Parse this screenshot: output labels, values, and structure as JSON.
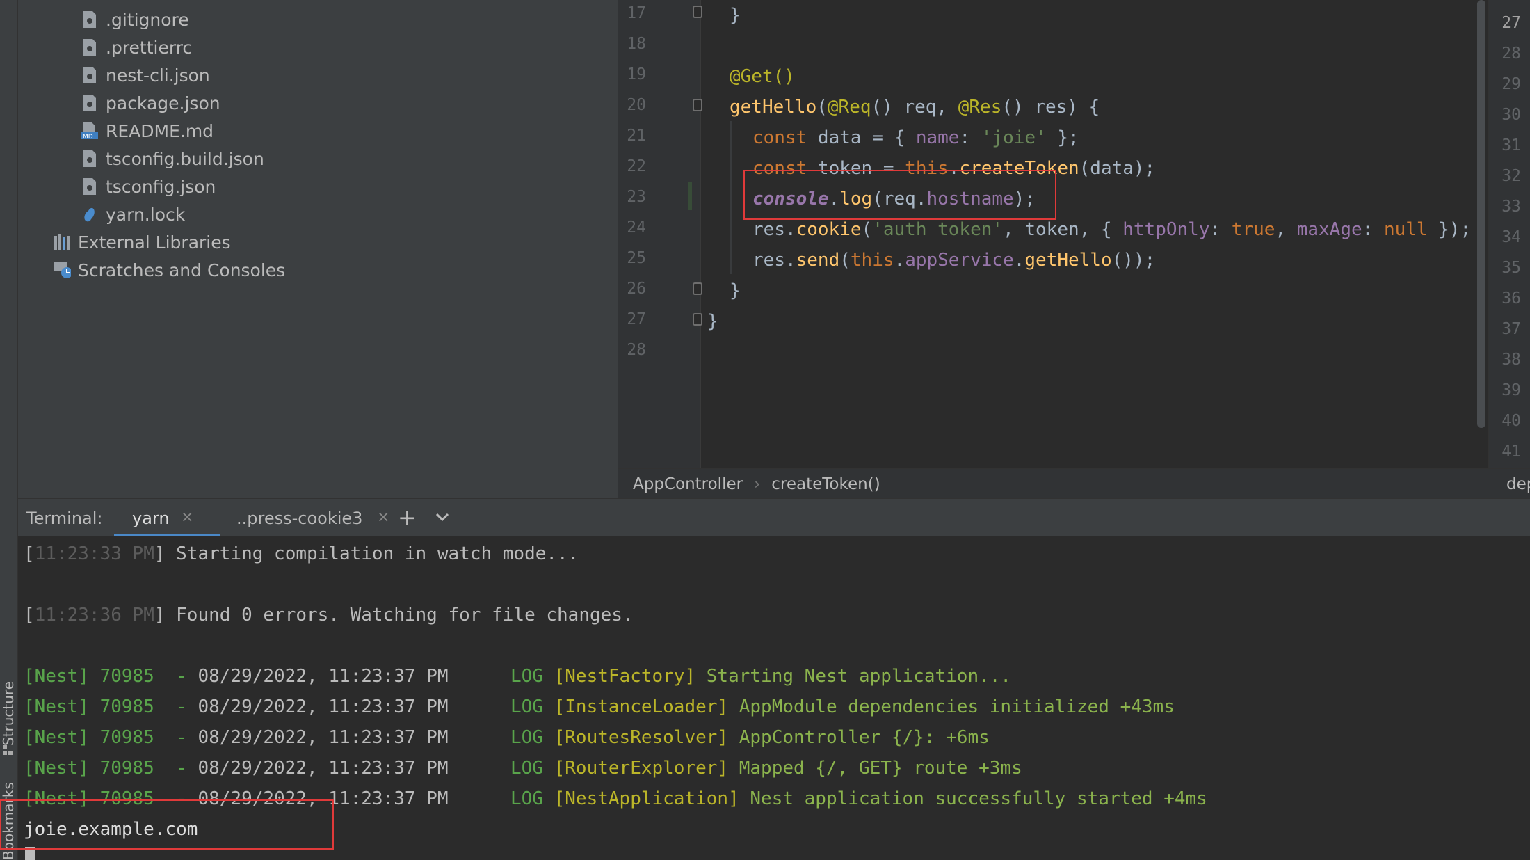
{
  "sidebar": {
    "vertical_tabs": [
      "Structure",
      "Bookmarks"
    ],
    "project_items": [
      {
        "label": ".gitignore",
        "icon": "config-file-icon"
      },
      {
        "label": ".prettierrc",
        "icon": "config-file-icon"
      },
      {
        "label": "nest-cli.json",
        "icon": "json-file-icon"
      },
      {
        "label": "package.json",
        "icon": "json-file-icon"
      },
      {
        "label": "README.md",
        "icon": "markdown-file-icon"
      },
      {
        "label": "tsconfig.build.json",
        "icon": "json-file-icon"
      },
      {
        "label": "tsconfig.json",
        "icon": "json-file-icon"
      },
      {
        "label": "yarn.lock",
        "icon": "yarn-icon"
      },
      {
        "label": "External Libraries",
        "icon": "library-icon"
      },
      {
        "label": "Scratches and Consoles",
        "icon": "scratches-icon"
      }
    ]
  },
  "editor": {
    "line_numbers": [
      "17",
      "18",
      "19",
      "20",
      "21",
      "22",
      "23",
      "24",
      "25",
      "26",
      "27",
      "28"
    ],
    "right_line_numbers": [
      "27",
      "28",
      "29",
      "30",
      "31",
      "32",
      "33",
      "34",
      "35",
      "36",
      "37",
      "38",
      "39",
      "40",
      "41"
    ],
    "code": {
      "l17": "}",
      "l19_decorator": "@Get()",
      "l20_method": "getHello",
      "l20_a": "(",
      "l20_req_dec": "@Req",
      "l20_b": "() req, ",
      "l20_res_dec": "@Res",
      "l20_c": "() res) {",
      "l21_kw": "const",
      "l21_a": " data = { ",
      "l21_prop": "name",
      "l21_b": ": ",
      "l21_str": "'joie'",
      "l21_c": " };",
      "l22_kw": "const",
      "l22_a": " token = ",
      "l22_this": "this",
      "l22_b": ".",
      "l22_fn": "createToken",
      "l22_c": "(data);",
      "l23_console": "console",
      "l23_a": ".",
      "l23_log": "log",
      "l23_b": "(req.",
      "l23_prop": "hostname",
      "l23_c": ");",
      "l24_a": "res.",
      "l24_fn": "cookie",
      "l24_b": "(",
      "l24_str": "'auth_token'",
      "l24_c": ", token, { ",
      "l24_p1": "httpOnly",
      "l24_d": ": ",
      "l24_v1": "true",
      "l24_e": ", ",
      "l24_p2": "maxAge",
      "l24_f": ": ",
      "l24_v2": "null",
      "l24_g": " });",
      "l25_a": "res.",
      "l25_fn": "send",
      "l25_b": "(",
      "l25_this": "this",
      "l25_c": ".",
      "l25_prop": "appService",
      "l25_d": ".",
      "l25_fn2": "getHello",
      "l25_e": "());",
      "l26": "}",
      "l27": "}"
    }
  },
  "breadcrumb": {
    "class_name": "AppController",
    "separator": "›",
    "method_name": "createToken()",
    "right_text": "dep"
  },
  "terminal": {
    "label": "Terminal:",
    "tabs": [
      {
        "label": "yarn",
        "active": true
      },
      {
        "label": "..press-cookie3",
        "active": false
      }
    ],
    "add_symbol": "+",
    "dropdown_symbol": "⌄",
    "lines": [
      {
        "time": "11:23:33 PM",
        "text": "Starting compilation in watch mode..."
      },
      {
        "time": "11:23:36 PM",
        "text": "Found 0 errors. Watching for file changes."
      }
    ],
    "nest_logs": [
      {
        "prefix": "[Nest] 70985  - ",
        "datetime": "08/29/2022, 11:23:37 PM",
        "level": "LOG",
        "context": "[NestFactory]",
        "message": "Starting Nest application..."
      },
      {
        "prefix": "[Nest] 70985  - ",
        "datetime": "08/29/2022, 11:23:37 PM",
        "level": "LOG",
        "context": "[InstanceLoader]",
        "message": "AppModule dependencies initialized +43ms"
      },
      {
        "prefix": "[Nest] 70985  - ",
        "datetime": "08/29/2022, 11:23:37 PM",
        "level": "LOG",
        "context": "[RoutesResolver]",
        "message": "AppController {/}: +6ms"
      },
      {
        "prefix": "[Nest] 70985  - ",
        "datetime": "08/29/2022, 11:23:37 PM",
        "level": "LOG",
        "context": "[RouterExplorer]",
        "message": "Mapped {/, GET} route +3ms"
      },
      {
        "prefix": "[Nest] 70985  - ",
        "datetime": "08/29/2022, 11:23:37 PM",
        "level": "LOG",
        "context": "[NestApplication]",
        "message": "Nest application successfully started +4ms"
      }
    ],
    "output": "joie.example.com"
  },
  "colors": {
    "highlight": "#e03a3a",
    "keyword": "#cc7832",
    "string": "#6a8759",
    "decorator": "#bbb529",
    "function": "#ffc66d",
    "property": "#9876aa"
  }
}
